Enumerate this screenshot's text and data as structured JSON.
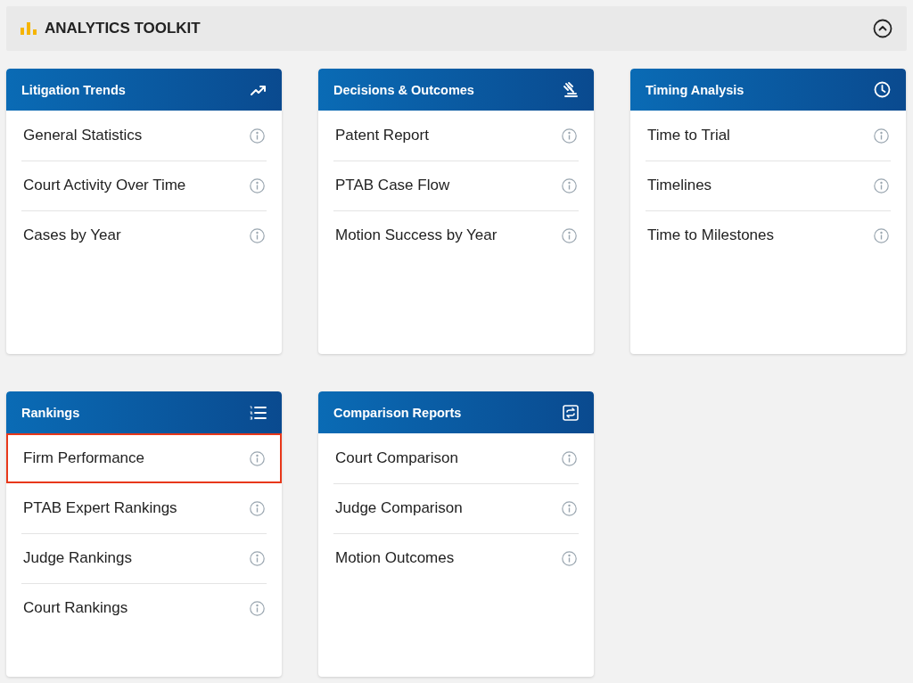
{
  "toolkit": {
    "title": "ANALYTICS TOOLKIT",
    "expanded": true
  },
  "sections": [
    {
      "kind": "trends",
      "title": "Litigation Trends",
      "items": [
        {
          "label": "General Statistics",
          "highlighted": false
        },
        {
          "label": "Court Activity Over Time",
          "highlighted": false
        },
        {
          "label": "Cases by Year",
          "highlighted": false
        }
      ]
    },
    {
      "kind": "decisions",
      "title": "Decisions & Outcomes",
      "items": [
        {
          "label": "Patent Report",
          "highlighted": false
        },
        {
          "label": "PTAB Case Flow",
          "highlighted": false
        },
        {
          "label": "Motion Success by Year",
          "highlighted": false
        }
      ]
    },
    {
      "kind": "timing",
      "title": "Timing Analysis",
      "items": [
        {
          "label": "Time to Trial",
          "highlighted": false
        },
        {
          "label": "Timelines",
          "highlighted": false
        },
        {
          "label": "Time to Milestones",
          "highlighted": false
        }
      ]
    },
    {
      "kind": "rankings",
      "title": "Rankings",
      "items": [
        {
          "label": "Firm Performance",
          "highlighted": true
        },
        {
          "label": "PTAB Expert Rankings",
          "highlighted": false
        },
        {
          "label": "Judge Rankings",
          "highlighted": false
        },
        {
          "label": "Court Rankings",
          "highlighted": false
        }
      ]
    },
    {
      "kind": "comparison",
      "title": "Comparison Reports",
      "items": [
        {
          "label": "Court Comparison",
          "highlighted": false
        },
        {
          "label": "Judge Comparison",
          "highlighted": false
        },
        {
          "label": "Motion Outcomes",
          "highlighted": false
        }
      ]
    }
  ]
}
